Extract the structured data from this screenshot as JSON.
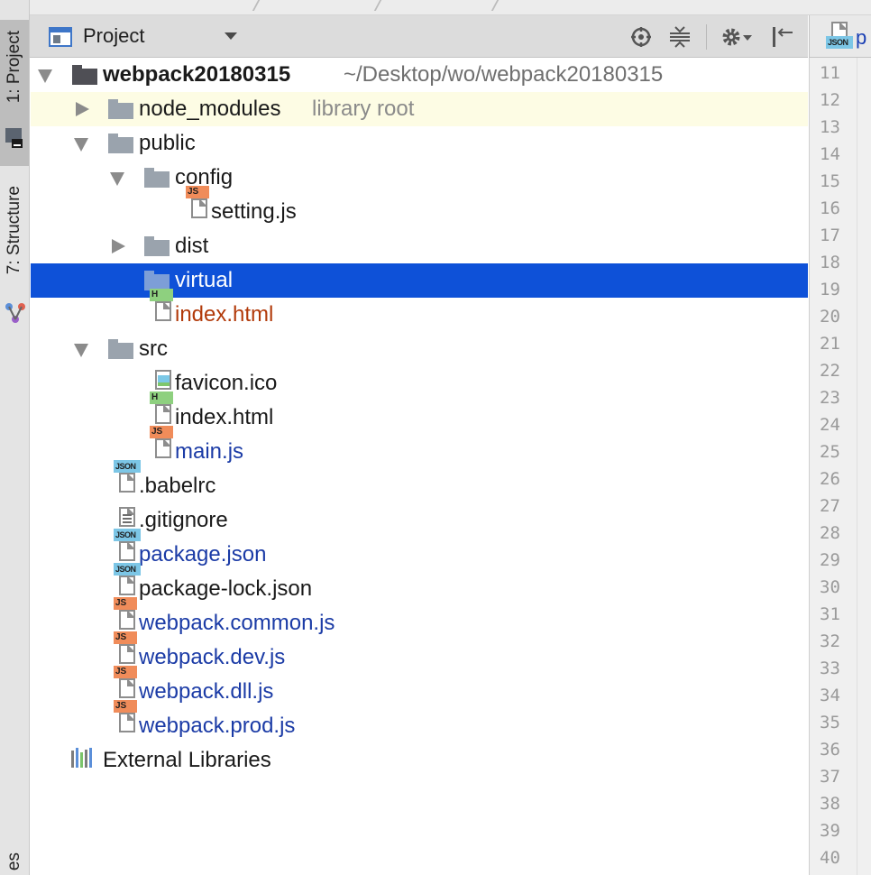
{
  "window": {
    "tool_title": "Project",
    "side_tabs": [
      "1: Project",
      "7: Structure"
    ],
    "bottom_stub": "es"
  },
  "toolbar": {
    "icons": [
      "locate-icon",
      "collapse-all-icon",
      "settings-icon",
      "hide-icon"
    ]
  },
  "editor": {
    "tab_text": "p",
    "tab_badge": "JSON",
    "line_numbers": [
      "11",
      "12",
      "13",
      "14",
      "15",
      "16",
      "17",
      "18",
      "19",
      "20",
      "21",
      "22",
      "23",
      "24",
      "25",
      "26",
      "27",
      "28",
      "29",
      "30",
      "31",
      "32",
      "33",
      "34",
      "35",
      "36",
      "37",
      "38",
      "39",
      "40"
    ]
  },
  "tree": {
    "root": {
      "name": "webpack20180315",
      "path": "~/Desktop/wo/webpack20180315"
    },
    "rows": [
      {
        "label": "node_modules",
        "note": "library root"
      },
      {
        "label": "public"
      },
      {
        "label": "config"
      },
      {
        "label": "setting.js",
        "badge": "JS"
      },
      {
        "label": "dist"
      },
      {
        "label": "virtual"
      },
      {
        "label": "index.html",
        "badge": "H"
      },
      {
        "label": "src"
      },
      {
        "label": "favicon.ico"
      },
      {
        "label": "index.html",
        "badge": "H"
      },
      {
        "label": "main.js",
        "badge": "JS"
      },
      {
        "label": ".babelrc",
        "badge": "JSON"
      },
      {
        "label": ".gitignore"
      },
      {
        "label": "package.json",
        "badge": "JSON"
      },
      {
        "label": "package-lock.json",
        "badge": "JSON"
      },
      {
        "label": "webpack.common.js",
        "badge": "JS"
      },
      {
        "label": "webpack.dev.js",
        "badge": "JS"
      },
      {
        "label": "webpack.dll.js",
        "badge": "JS"
      },
      {
        "label": "webpack.prod.js",
        "badge": "JS"
      },
      {
        "label": "External Libraries"
      }
    ]
  },
  "colors": {
    "selection": "#0e51d8",
    "modified_blue": "#1b3ba6",
    "unversioned_red": "#b23a0a",
    "js_badge": "#f08c5a",
    "html_badge": "#8ed07f",
    "json_badge": "#7cc6e6"
  }
}
